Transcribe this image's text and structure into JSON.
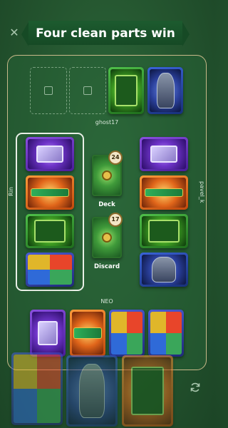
{
  "header": {
    "title": "Four clean parts win",
    "close_icon": "close-icon"
  },
  "opponent_top": {
    "name": "ghost17",
    "empty_slots": [
      {
        "icon": "cpu-slot-icon"
      },
      {
        "icon": "card-slot-icon"
      }
    ],
    "cards": [
      {
        "color": "green",
        "part": "motherboard"
      },
      {
        "color": "blue",
        "part": "armor"
      }
    ]
  },
  "player_left": {
    "name": "Rin",
    "cards": [
      {
        "color": "purple",
        "part": "cpu"
      },
      {
        "color": "orange",
        "part": "ram"
      },
      {
        "color": "green",
        "part": "motherboard"
      },
      {
        "color": "multi",
        "part": "virus"
      }
    ]
  },
  "player_right": {
    "name": "pavel_k",
    "cards": [
      {
        "color": "purple",
        "part": "cpu"
      },
      {
        "color": "orange",
        "part": "ram"
      },
      {
        "color": "green",
        "part": "motherboard"
      },
      {
        "color": "blue",
        "part": "armor"
      }
    ]
  },
  "center": {
    "deck_label": "Deck",
    "deck_count": "24",
    "discard_label": "Discard",
    "discard_count": "17"
  },
  "player_bottom": {
    "name": "NEO",
    "cards": [
      {
        "color": "purple",
        "part": "cpu"
      },
      {
        "color": "orange",
        "part": "ram"
      },
      {
        "color": "multi",
        "part": "virus"
      },
      {
        "color": "multi",
        "part": "virus"
      }
    ]
  },
  "hand": {
    "cards": [
      {
        "color": "multi",
        "part": "virus"
      },
      {
        "color": "blue",
        "part": "armor"
      },
      {
        "color": "orange",
        "part": "motherboard"
      }
    ],
    "refresh_icon": "refresh-icon"
  },
  "colors": {
    "board_border": "#c9b98a",
    "banner": "#164a25",
    "background": "#24552f"
  }
}
